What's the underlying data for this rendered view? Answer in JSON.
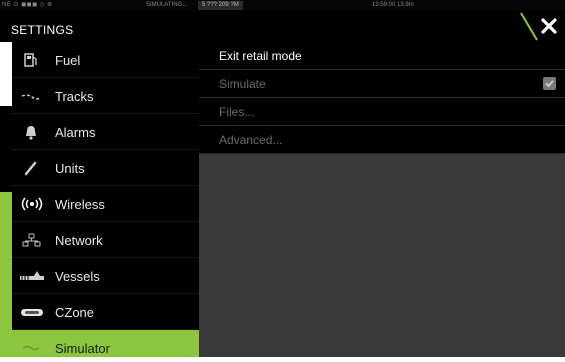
{
  "status_bar": {
    "icons_text": "NE ⊙ ◼◼◼ ◇ ⊛",
    "mode": "SIMULATING...",
    "position": "5 ??? 209 ?M",
    "time": "13:59:00  13.9m"
  },
  "header": {
    "title": "SETTINGS",
    "close_icon": "close-x-icon"
  },
  "colors": {
    "accent": "#8cc63f",
    "panel_bg": "#3a3a3a",
    "sidebar_bg": "#000000"
  },
  "sidebar": {
    "items": [
      {
        "label": "Fuel",
        "icon": "fuel-icon",
        "selected": false
      },
      {
        "label": "Tracks",
        "icon": "tracks-icon",
        "selected": false
      },
      {
        "label": "Alarms",
        "icon": "bell-icon",
        "selected": false
      },
      {
        "label": "Units",
        "icon": "ruler-icon",
        "selected": false
      },
      {
        "label": "Wireless",
        "icon": "wireless-icon",
        "selected": false
      },
      {
        "label": "Network",
        "icon": "network-icon",
        "selected": false
      },
      {
        "label": "Vessels",
        "icon": "vessels-icon",
        "selected": false
      },
      {
        "label": "CZone",
        "icon": "czone-icon",
        "selected": false
      },
      {
        "label": "Simulator",
        "icon": "simulator-icon",
        "selected": true
      }
    ]
  },
  "menu": {
    "items": [
      {
        "label": "Exit retail mode",
        "enabled": true
      },
      {
        "label": "Simulate",
        "enabled": false,
        "checked": true
      },
      {
        "label": "Files...",
        "enabled": false
      },
      {
        "label": "Advanced...",
        "enabled": false
      }
    ]
  }
}
